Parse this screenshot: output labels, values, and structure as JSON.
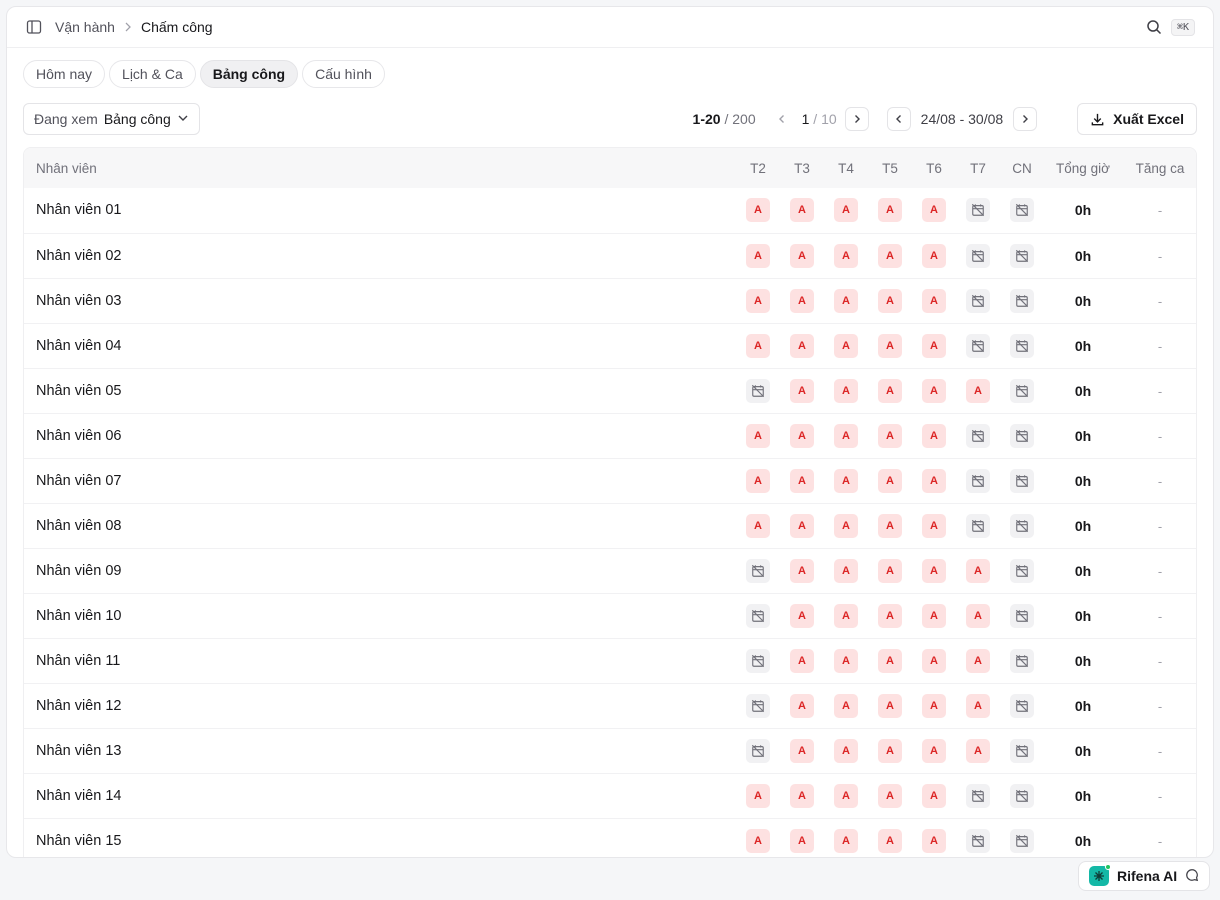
{
  "breadcrumb": {
    "parent": "Vận hành",
    "current": "Chấm công"
  },
  "shortcut": "⌘K",
  "tabs": [
    {
      "label": "Hôm nay",
      "active": false
    },
    {
      "label": "Lịch & Ca",
      "active": false
    },
    {
      "label": "Bảng công",
      "active": true
    },
    {
      "label": "Cấu hình",
      "active": false
    }
  ],
  "view_select": {
    "label": "Đang xem",
    "value": "Bảng công"
  },
  "pagination": {
    "range": "1-20",
    "total": "/ 200",
    "page": "1",
    "pages": "/ 10"
  },
  "week_range": "24/08 - 30/08",
  "export_label": "Xuất Excel",
  "table": {
    "headers": {
      "name": "Nhân viên",
      "days": [
        "T2",
        "T3",
        "T4",
        "T5",
        "T6",
        "T7",
        "CN"
      ],
      "total": "Tổng giờ",
      "overtime": "Tăng ca"
    },
    "absent_mark": "A",
    "rows": [
      {
        "name": "Nhân viên 01",
        "days": [
          "A",
          "A",
          "A",
          "A",
          "A",
          "off",
          "off"
        ],
        "total": "0h",
        "overtime": "-"
      },
      {
        "name": "Nhân viên 02",
        "days": [
          "A",
          "A",
          "A",
          "A",
          "A",
          "off",
          "off"
        ],
        "total": "0h",
        "overtime": "-"
      },
      {
        "name": "Nhân viên 03",
        "days": [
          "A",
          "A",
          "A",
          "A",
          "A",
          "off",
          "off"
        ],
        "total": "0h",
        "overtime": "-"
      },
      {
        "name": "Nhân viên 04",
        "days": [
          "A",
          "A",
          "A",
          "A",
          "A",
          "off",
          "off"
        ],
        "total": "0h",
        "overtime": "-"
      },
      {
        "name": "Nhân viên 05",
        "days": [
          "off",
          "A",
          "A",
          "A",
          "A",
          "A",
          "off"
        ],
        "total": "0h",
        "overtime": "-"
      },
      {
        "name": "Nhân viên 06",
        "days": [
          "A",
          "A",
          "A",
          "A",
          "A",
          "off",
          "off"
        ],
        "total": "0h",
        "overtime": "-"
      },
      {
        "name": "Nhân viên 07",
        "days": [
          "A",
          "A",
          "A",
          "A",
          "A",
          "off",
          "off"
        ],
        "total": "0h",
        "overtime": "-"
      },
      {
        "name": "Nhân viên 08",
        "days": [
          "A",
          "A",
          "A",
          "A",
          "A",
          "off",
          "off"
        ],
        "total": "0h",
        "overtime": "-"
      },
      {
        "name": "Nhân viên 09",
        "days": [
          "off",
          "A",
          "A",
          "A",
          "A",
          "A",
          "off"
        ],
        "total": "0h",
        "overtime": "-"
      },
      {
        "name": "Nhân viên 10",
        "days": [
          "off",
          "A",
          "A",
          "A",
          "A",
          "A",
          "off"
        ],
        "total": "0h",
        "overtime": "-"
      },
      {
        "name": "Nhân viên 11",
        "days": [
          "off",
          "A",
          "A",
          "A",
          "A",
          "A",
          "off"
        ],
        "total": "0h",
        "overtime": "-"
      },
      {
        "name": "Nhân viên 12",
        "days": [
          "off",
          "A",
          "A",
          "A",
          "A",
          "A",
          "off"
        ],
        "total": "0h",
        "overtime": "-"
      },
      {
        "name": "Nhân viên 13",
        "days": [
          "off",
          "A",
          "A",
          "A",
          "A",
          "A",
          "off"
        ],
        "total": "0h",
        "overtime": "-"
      },
      {
        "name": "Nhân viên 14",
        "days": [
          "A",
          "A",
          "A",
          "A",
          "A",
          "off",
          "off"
        ],
        "total": "0h",
        "overtime": "-"
      },
      {
        "name": "Nhân viên 15",
        "days": [
          "A",
          "A",
          "A",
          "A",
          "A",
          "off",
          "off"
        ],
        "total": "0h",
        "overtime": "-"
      }
    ]
  },
  "ai_button": {
    "label": "Rifena AI"
  },
  "colors": {
    "absent_bg": "#fde1e1",
    "absent_text": "#dc2626",
    "off_bg": "#f1f1f3",
    "accent": "#14b8a6"
  },
  "icons": {
    "sidebar": "sidebar-toggle-icon",
    "search": "search-icon",
    "day_off": "calendar-off-icon",
    "export": "download-icon",
    "chat": "chat-icon"
  }
}
